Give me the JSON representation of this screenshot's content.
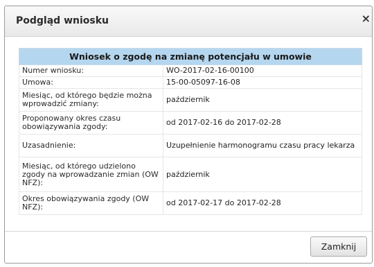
{
  "dialog": {
    "title": "Podgląd wniosku",
    "close_icon": "×",
    "table_header": "Wniosek o zgodę na zmianę potencjału w umowie",
    "rows": [
      {
        "label": "Numer wniosku:",
        "value": "WO-2017-02-16-00100"
      },
      {
        "label": "Umowa:",
        "value": "15-00-05097-16-08"
      },
      {
        "label": "Miesiąc, od którego będzie można wprowadzić zmiany:",
        "value": "październik"
      },
      {
        "label": "Proponowany okres czasu obowiązywania zgody:",
        "value": "od 2017-02-16 do 2017-02-28"
      },
      {
        "label": "Uzasadnienie:",
        "value": "Uzupełnienie harmonogramu czasu pracy lekarza"
      },
      {
        "label": "Miesiąc, od którego udzielono zgody na wprowadzanie zmian (OW NFZ):",
        "value": "październik"
      },
      {
        "label": "Okres obowiązywania zgody (OW NFZ):",
        "value": "od 2017-02-17 do 2017-02-28"
      }
    ],
    "close_button_label": "Zamknij"
  }
}
